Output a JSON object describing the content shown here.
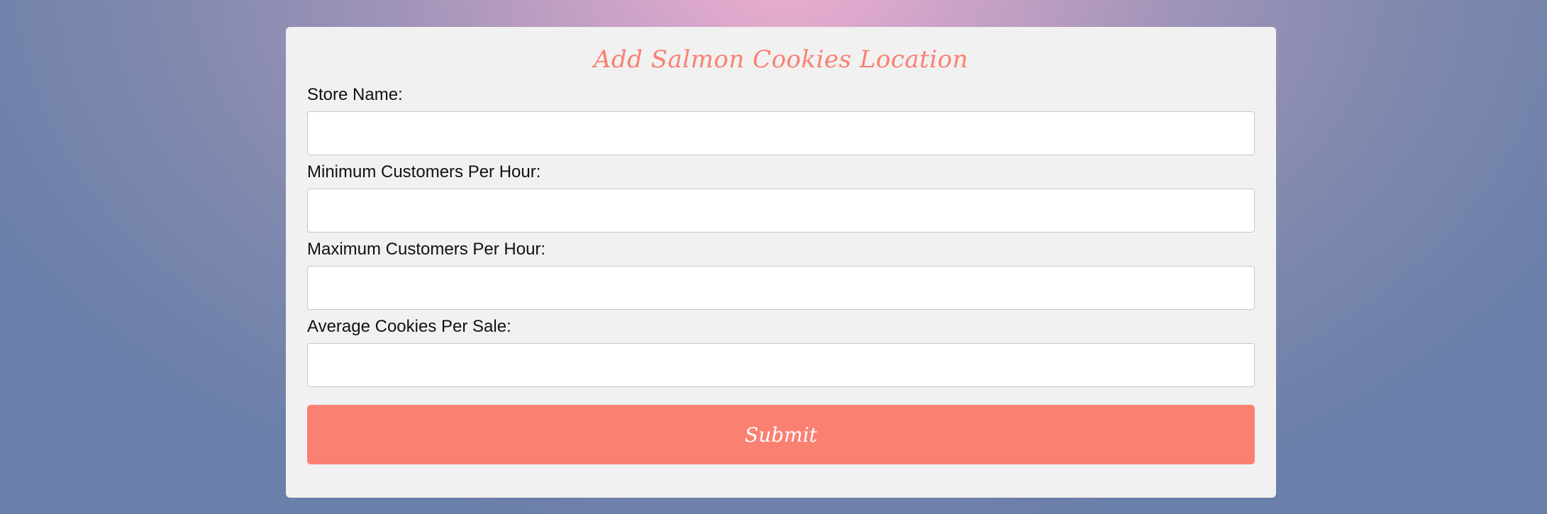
{
  "form": {
    "title": "Add Salmon Cookies Location",
    "fields": [
      {
        "label": "Store Name:",
        "value": "",
        "placeholder": ""
      },
      {
        "label": "Minimum Customers Per Hour:",
        "value": "",
        "placeholder": ""
      },
      {
        "label": "Maximum Customers Per Hour:",
        "value": "",
        "placeholder": ""
      },
      {
        "label": "Average Cookies Per Sale:",
        "value": "",
        "placeholder": ""
      }
    ],
    "submit_label": "Submit"
  },
  "colors": {
    "accent": "#fa8072",
    "card_background": "#f1f1f1",
    "page_gradient_center": "#eeaed0",
    "page_gradient_edge": "#6a7fa9"
  }
}
